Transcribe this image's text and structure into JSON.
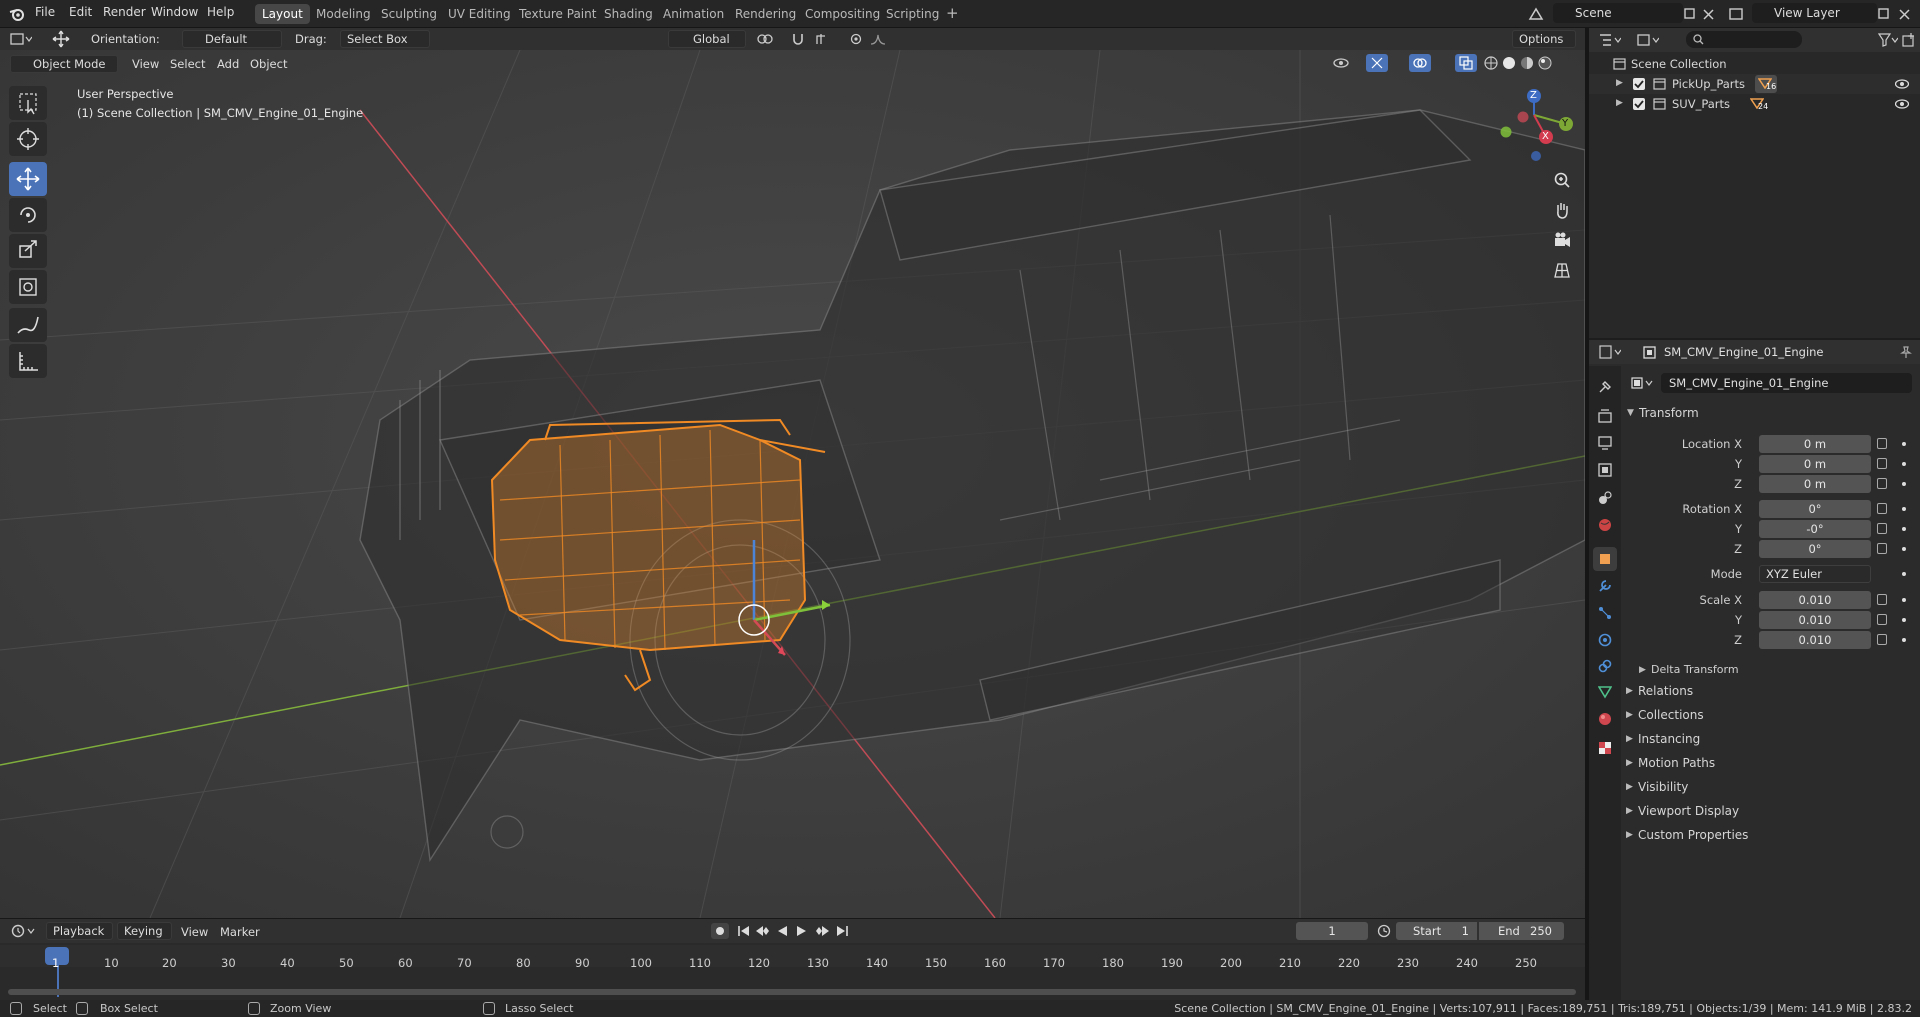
{
  "topbar": {
    "menus": [
      "File",
      "Edit",
      "Render",
      "Window",
      "Help"
    ],
    "workspaces": [
      "Layout",
      "Modeling",
      "Sculpting",
      "UV Editing",
      "Texture Paint",
      "Shading",
      "Animation",
      "Rendering",
      "Compositing",
      "Scripting"
    ],
    "add_tab_symbol": "+",
    "scene": "Scene",
    "view_layer": "View Layer"
  },
  "tool_header": {
    "orientation_label": "Orientation:",
    "orientation_value": "Default",
    "drag_label": "Drag:",
    "drag_value": "Select Box",
    "transform_orientation": "Global",
    "options": "Options"
  },
  "viewport_header": {
    "mode": "Object Mode",
    "menus": [
      "View",
      "Select",
      "Add",
      "Object"
    ]
  },
  "viewport": {
    "perspective": "User Perspective",
    "collection_info": "(1) Scene Collection | SM_CMV_Engine_01_Engine",
    "gizmo_axes": [
      "X",
      "Y",
      "Z"
    ]
  },
  "outliner": {
    "root": "Scene Collection",
    "items": [
      {
        "name": "PickUp_Parts",
        "count": "16"
      },
      {
        "name": "SUV_Parts",
        "count": "24"
      }
    ]
  },
  "properties": {
    "object_name": "SM_CMV_Engine_01_Engine",
    "name_field": "SM_CMV_Engine_01_Engine",
    "transform_title": "Transform",
    "location_label": "Location X",
    "rotation_label": "Rotation X",
    "scale_label": "Scale X",
    "y_label": "Y",
    "z_label": "Z",
    "location": [
      "0 m",
      "0 m",
      "0 m"
    ],
    "rotation": [
      "0°",
      "-0°",
      "0°"
    ],
    "mode_label": "Mode",
    "mode_value": "XYZ Euler",
    "scale": [
      "0.010",
      "0.010",
      "0.010"
    ],
    "delta_transform": "Delta Transform",
    "panels": [
      "Relations",
      "Collections",
      "Instancing",
      "Motion Paths",
      "Visibility",
      "Viewport Display",
      "Custom Properties"
    ]
  },
  "timeline": {
    "menus": [
      "Playback",
      "Keying",
      "View",
      "Marker"
    ],
    "current_frame": "1",
    "start_label": "Start",
    "start": "1",
    "end_label": "End",
    "end": "250",
    "ruler": [
      "1",
      "10",
      "20",
      "30",
      "40",
      "50",
      "60",
      "70",
      "80",
      "90",
      "100",
      "110",
      "120",
      "130",
      "140",
      "150",
      "160",
      "170",
      "180",
      "190",
      "200",
      "210",
      "220",
      "230",
      "240",
      "250"
    ]
  },
  "status": {
    "select": "Select",
    "box_select": "Box Select",
    "zoom_view": "Zoom View",
    "lasso_select": "Lasso Select",
    "stats": "Scene Collection | SM_CMV_Engine_01_Engine | Verts:107,911 | Faces:189,751 | Tris:189,751 | Objects:1/39 | Mem: 141.9 MiB | 2.83.2"
  }
}
